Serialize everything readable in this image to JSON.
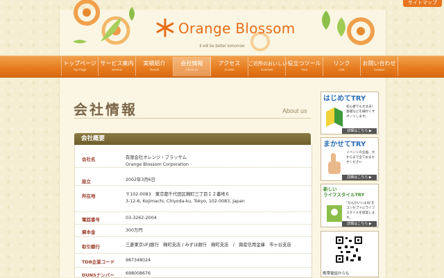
{
  "header": {
    "logo_text": "Orange Blossom",
    "tagline": "it will be better tomorrow",
    "sitemap_label": "サイトマップ"
  },
  "nav": {
    "items": [
      {
        "jp": "トップページ",
        "en": "Top Page"
      },
      {
        "jp": "サービス案内",
        "en": "Service"
      },
      {
        "jp": "実績紹介",
        "en": "Result"
      },
      {
        "jp": "会社情報",
        "en": "About us"
      },
      {
        "jp": "アクセス",
        "en": "Access"
      },
      {
        "jp": "ご近所のおいしい",
        "en": "Gourmet"
      },
      {
        "jp": "役立つツール",
        "en": "Tool"
      },
      {
        "jp": "リンク",
        "en": "Link"
      },
      {
        "jp": "お問い合わせ",
        "en": "Contact"
      }
    ],
    "active_index": 3
  },
  "page": {
    "title": "会社情報",
    "title_en": "About us"
  },
  "section": {
    "header": "会社概要",
    "rows": [
      {
        "label": "会社名",
        "value1": "有限会社オレンジ・ブラッサム",
        "value2": "Orange Blossom Corporation"
      },
      {
        "label": "設立",
        "value1": "2002年3月6日",
        "value2": ""
      },
      {
        "label": "所在地",
        "value1": "〒102-0083　東京都千代田区麹町三丁目１２番地６",
        "value2": "3-12-6, Kojimachi, Chiyoda-ku, Tokyo, 102-0083, Japan"
      },
      {
        "label": "電話番号",
        "value1": "03-3262-2004",
        "value2": ""
      },
      {
        "label": "資本金",
        "value1": "300万円",
        "value2": ""
      },
      {
        "label": "取引銀行",
        "value1": "三菱東京UFJ銀行　麹町支店 / みずほ銀行　麹町支店　/　興産信用金庫　市ヶ谷支店",
        "value2": ""
      },
      {
        "label": "TDB企業コード",
        "value1": "987348024",
        "value2": ""
      },
      {
        "label": "DUNSナンバー",
        "value1": "698008676",
        "value2": ""
      }
    ]
  },
  "sidebar": {
    "banners": [
      {
        "title": "はじめてTRY",
        "body": "初心者でも大丈夫！基礎などを細かくサポートします。",
        "button": "詳細はこちら ▶",
        "color": "#2b6db5"
      },
      {
        "title": "まかせてTRY",
        "body": "イベントの企画、大からまで全ておまかせください",
        "button": "詳細はこちら ▶",
        "color": "#2b6db5"
      },
      {
        "title": "新しいライフスタイルTRY",
        "title_line1": "新しい",
        "title_line2": "ライフスタイルTRY",
        "body": "\"なんかいいよね\"をコンセプトにライフスタイルを提案します。",
        "button": "詳細はこちら ▶",
        "color": "#3e8b2a"
      }
    ],
    "qr_caption": "携帯電話からも"
  },
  "colors": {
    "accent": "#e67b1e",
    "nav_gradient_top": "#f0a04c",
    "section_header": "#7a6a36",
    "label_red": "#9a3d2a"
  }
}
